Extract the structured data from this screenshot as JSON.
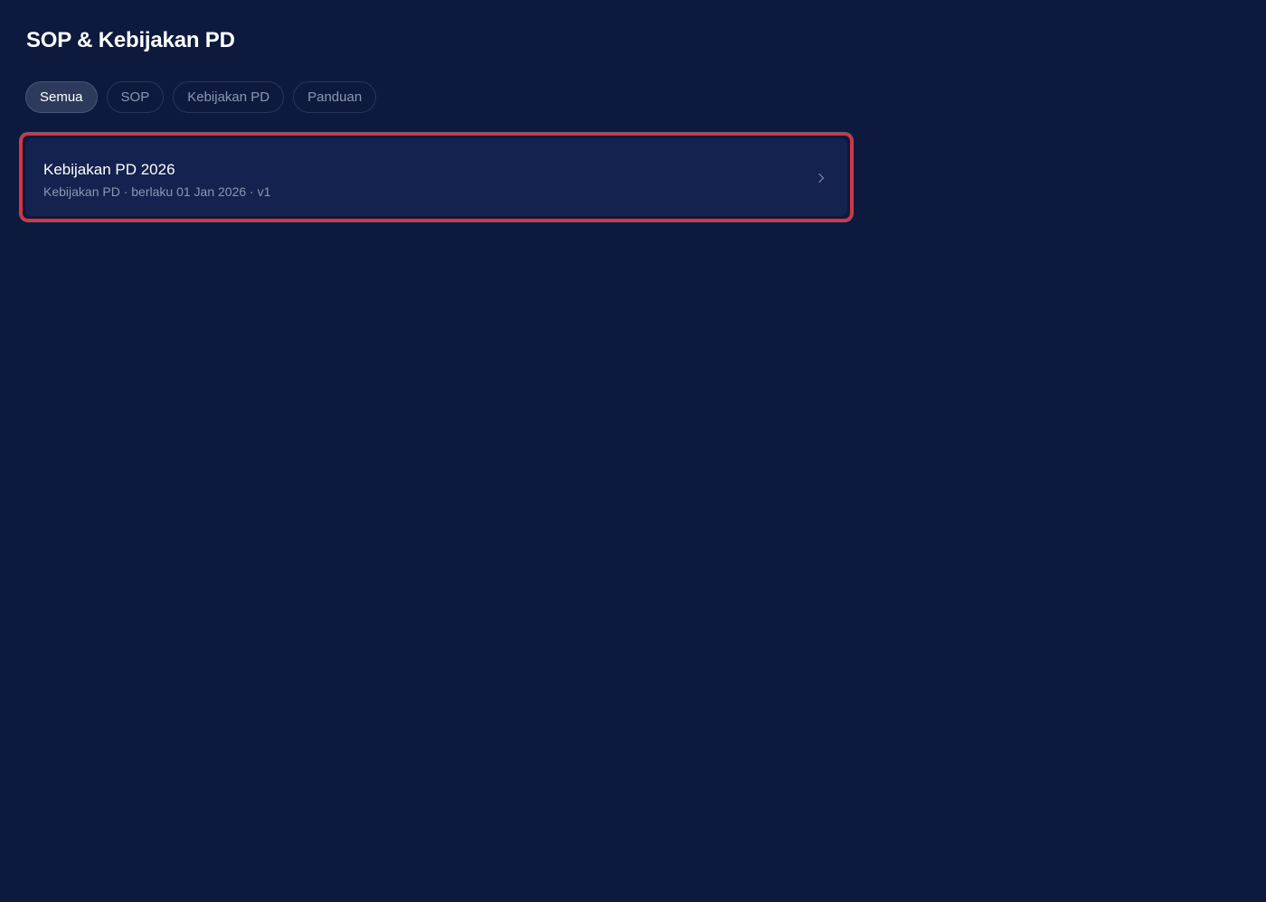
{
  "page": {
    "title": "SOP & Kebijakan PD"
  },
  "filters": {
    "tabs": [
      {
        "label": "Semua",
        "active": true
      },
      {
        "label": "SOP",
        "active": false
      },
      {
        "label": "Kebijakan PD",
        "active": false
      },
      {
        "label": "Panduan",
        "active": false
      }
    ]
  },
  "documents": [
    {
      "title": "Kebijakan PD 2026",
      "meta": "Kebijakan PD · berlaku 01 Jan 2026 · v1",
      "icon": "chevron-right-icon"
    }
  ],
  "colors": {
    "background": "#0d1a3d",
    "card": "#13224e",
    "highlight": "#e0303c",
    "active_tab": "#2d3a5c",
    "muted_text": "#8c97b3"
  }
}
